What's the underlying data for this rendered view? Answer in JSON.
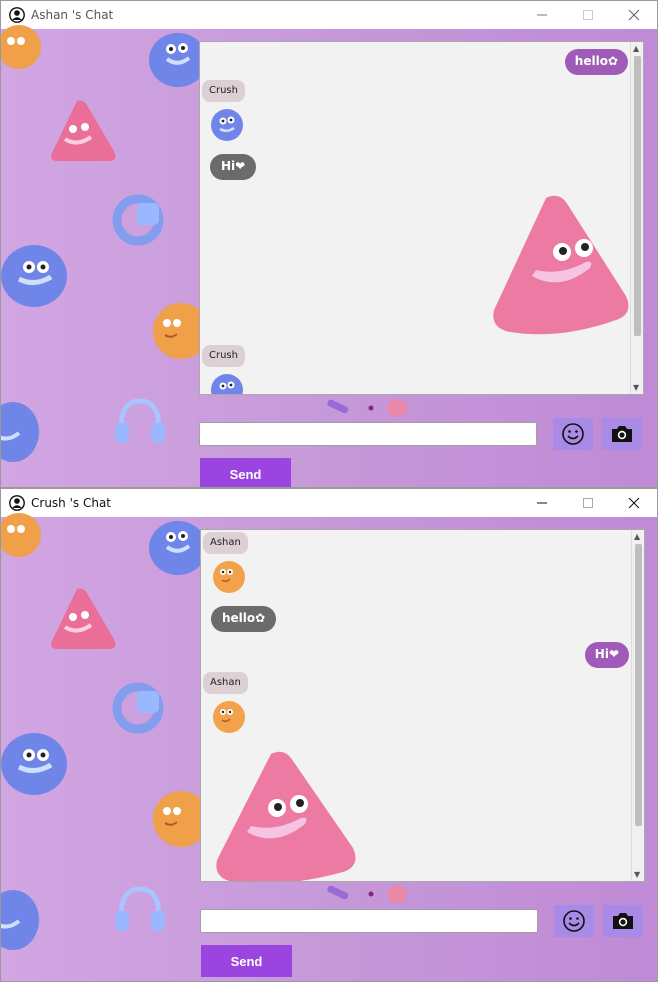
{
  "windows": [
    {
      "title": "Ashan 's Chat",
      "messages": [
        {
          "side": "right",
          "text": "hello✿"
        },
        {
          "side": "left",
          "sender": "Crush",
          "avatar": "blue-fluffy-avatar"
        },
        {
          "side": "left",
          "text": "Hi❤"
        },
        {
          "side": "left",
          "type": "sticker",
          "sticker": "pink-triangle-sticker"
        },
        {
          "side": "left",
          "sender": "Crush",
          "avatar": "blue-fluffy-avatar"
        }
      ],
      "input": {
        "value": "",
        "placeholder": ""
      },
      "send_label": "Send",
      "emoji_icon": "smiley-icon",
      "camera_icon": "camera-icon"
    },
    {
      "title": "Crush 's Chat",
      "messages": [
        {
          "side": "left",
          "sender": "Ashan",
          "avatar": "orange-fluffy-avatar"
        },
        {
          "side": "left",
          "text": "hello✿"
        },
        {
          "side": "right",
          "text": "Hi❤"
        },
        {
          "side": "left",
          "sender": "Ashan",
          "avatar": "orange-fluffy-avatar"
        },
        {
          "side": "left",
          "type": "sticker",
          "sticker": "pink-triangle-sticker"
        }
      ],
      "input": {
        "value": "",
        "placeholder": ""
      },
      "send_label": "Send",
      "emoji_icon": "smiley-icon",
      "camera_icon": "camera-icon"
    }
  ],
  "colors": {
    "background": "#c99ddb",
    "send_button": "#9a45e0",
    "icon_button": "#a98ae6",
    "bubble_left": "#6b6b6b",
    "bubble_right": "#a05bb8",
    "name_tag": "#ddd0d4"
  }
}
